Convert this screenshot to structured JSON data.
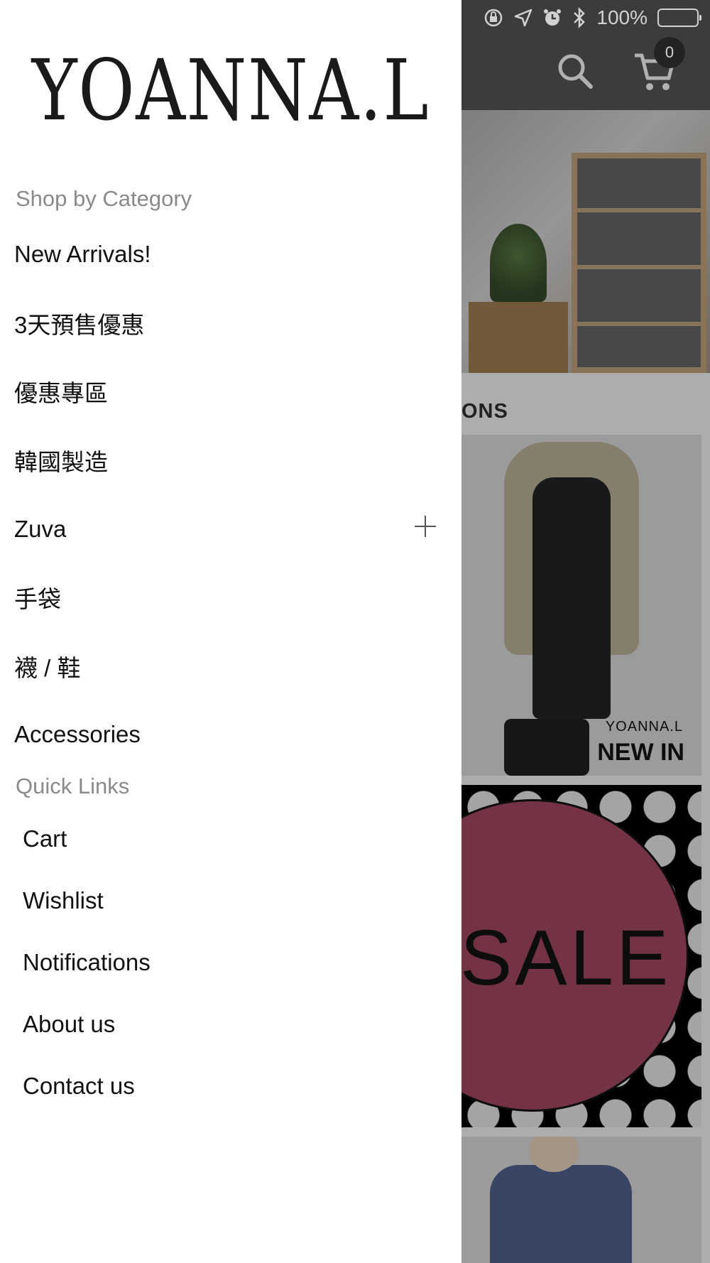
{
  "status_bar": {
    "battery_text": "100%",
    "icons": [
      "orientation-lock-icon",
      "location-icon",
      "alarm-icon",
      "bluetooth-icon",
      "battery-icon"
    ]
  },
  "header": {
    "cart_count": "0",
    "icons": [
      "search-icon",
      "cart-icon"
    ]
  },
  "content": {
    "section_label": "ONS",
    "newin_brand": "YOANNA.L",
    "newin_title": "NEW IN",
    "sale_text": "SALE"
  },
  "drawer": {
    "logo_text": "YOANNA.L",
    "shop_heading": "Shop by Category",
    "categories": [
      {
        "label": "New Arrivals!"
      },
      {
        "label": "3天預售優惠"
      },
      {
        "label": "優惠專區"
      },
      {
        "label": "韓國製造"
      },
      {
        "label": "Zuva",
        "expandable": true
      },
      {
        "label": "手袋"
      },
      {
        "label": "襪 / 鞋"
      },
      {
        "label": "Accessories"
      }
    ],
    "quick_heading": "Quick Links",
    "quick_links": [
      {
        "label": "Cart"
      },
      {
        "label": "Wishlist"
      },
      {
        "label": "Notifications"
      },
      {
        "label": "About us"
      },
      {
        "label": "Contact us"
      }
    ]
  },
  "colors": {
    "header_bg": "#4a4a4a",
    "drawer_bg": "#ffffff",
    "heading_gray": "#8a8a8a",
    "sale_circle": "#8d3f54"
  }
}
